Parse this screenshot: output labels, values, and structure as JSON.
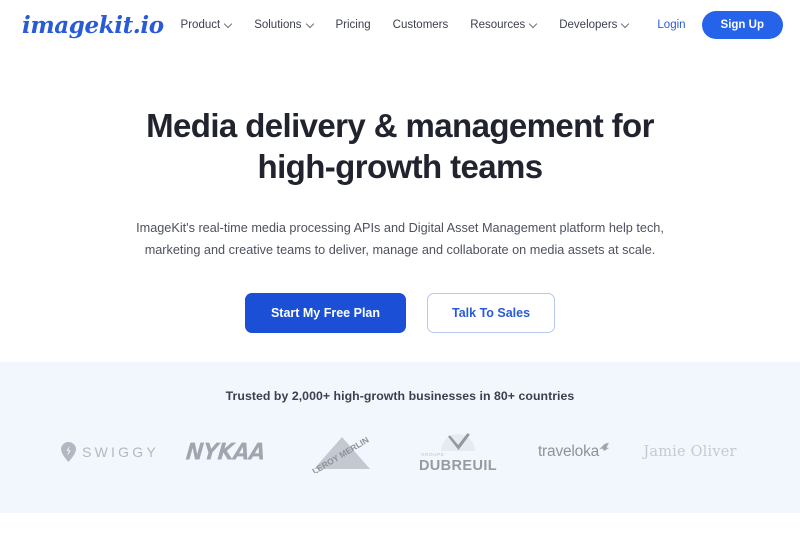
{
  "nav": {
    "brand": "imagekit.io",
    "brand_icon": "imagekit-wordmark-logo",
    "links": [
      {
        "label": "Product",
        "has_dropdown": true
      },
      {
        "label": "Solutions",
        "has_dropdown": true
      },
      {
        "label": "Pricing",
        "has_dropdown": false
      },
      {
        "label": "Customers",
        "has_dropdown": false
      },
      {
        "label": "Resources",
        "has_dropdown": true
      },
      {
        "label": "Developers",
        "has_dropdown": true
      }
    ],
    "login_label": "Login",
    "signup_label": "Sign Up"
  },
  "hero": {
    "title_line1": "Media delivery & management for",
    "title_line2": "high-growth teams",
    "subtitle": "ImageKit's real-time media processing APIs and Digital Asset Management platform help tech, marketing and creative teams to deliver, manage and collaborate on media assets at scale.",
    "primary_cta": "Start My Free Plan",
    "secondary_cta": "Talk To Sales"
  },
  "trusted": {
    "heading": "Trusted by 2,000+ high-growth businesses in 80+ countries",
    "logos": [
      {
        "name": "swiggy",
        "text": "SWIGGY"
      },
      {
        "name": "nykaa",
        "text": "NYKAA"
      },
      {
        "name": "leroy-merlin",
        "text": "LEROY MERLIN"
      },
      {
        "name": "dubreuil",
        "text": "DUBREUIL",
        "sub": "GROUPE"
      },
      {
        "name": "traveloka",
        "text": "traveloka"
      },
      {
        "name": "jamie-oliver",
        "text": "Jamie Oliver"
      }
    ]
  },
  "colors": {
    "brand_blue": "#2a5bd7",
    "button_blue": "#1a4fd6",
    "signup_blue": "#2563eb",
    "heading_dark": "#21232e",
    "body_gray": "#4d5160",
    "trusted_bg": "#f2f6fd",
    "logo_gray": "#8d929f"
  }
}
